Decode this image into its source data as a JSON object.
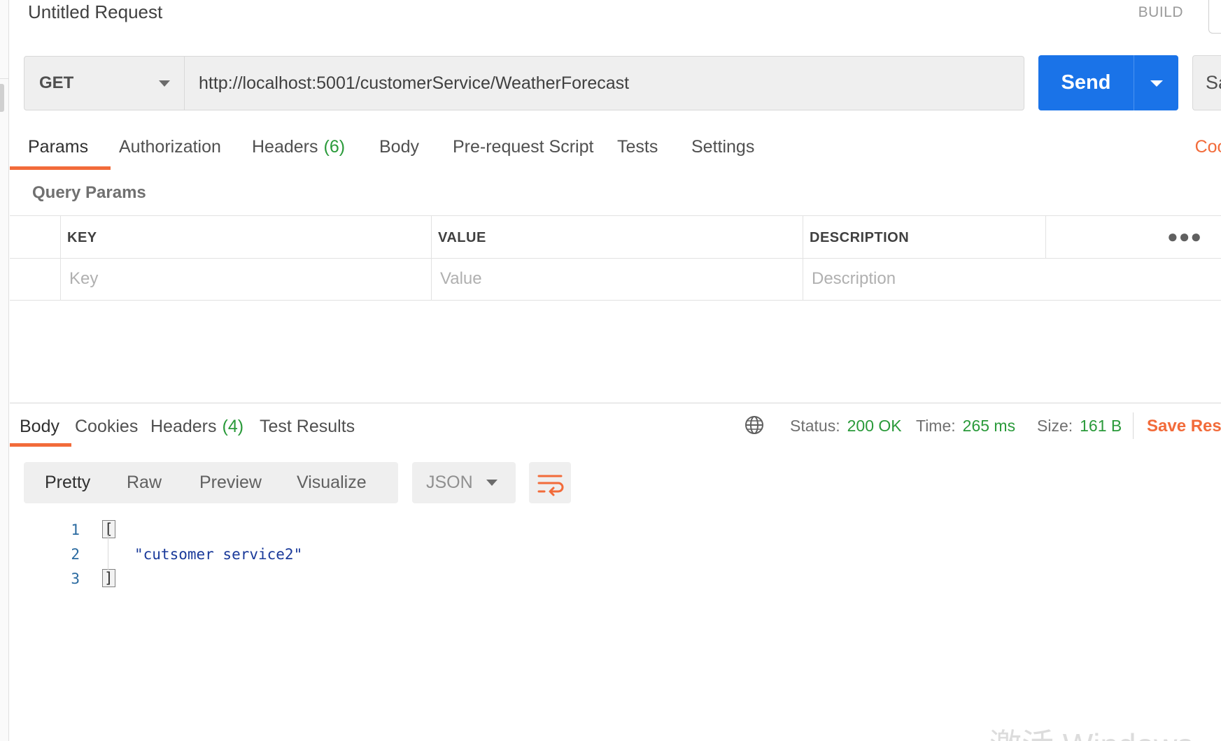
{
  "request": {
    "title": "Untitled Request",
    "build_label": "BUILD",
    "method": "GET",
    "url": "http://localhost:5001/customerService/WeatherForecast",
    "send_label": "Send",
    "save_label": "Sa"
  },
  "request_tabs": [
    {
      "label": "Params",
      "count": "",
      "active": true
    },
    {
      "label": "Authorization",
      "count": ""
    },
    {
      "label": "Headers",
      "count": "(6)"
    },
    {
      "label": "Body",
      "count": ""
    },
    {
      "label": "Pre-request Script",
      "count": ""
    },
    {
      "label": "Tests",
      "count": ""
    },
    {
      "label": "Settings",
      "count": ""
    }
  ],
  "cookies_label": "Cool",
  "query_params": {
    "title": "Query Params",
    "columns": [
      "KEY",
      "VALUE",
      "DESCRIPTION"
    ],
    "placeholders": [
      "Key",
      "Value",
      "Description"
    ],
    "more_icon": "ellipsis-icon"
  },
  "response_tabs": [
    {
      "label": "Body",
      "count": "",
      "active": true
    },
    {
      "label": "Cookies",
      "count": ""
    },
    {
      "label": "Headers",
      "count": "(4)"
    },
    {
      "label": "Test Results",
      "count": ""
    }
  ],
  "response_status": {
    "globe_icon": "globe-icon",
    "status_label": "Status:",
    "status_value": "200 OK",
    "time_label": "Time:",
    "time_value": "265 ms",
    "size_label": "Size:",
    "size_value": "161 B",
    "save_response_label": "Save Res"
  },
  "format_options": [
    "Pretty",
    "Raw",
    "Preview",
    "Visualize"
  ],
  "format_active": "Pretty",
  "language": "JSON",
  "wrap_icon": "wrap-lines-icon",
  "code_lines": [
    {
      "num": "1",
      "text": "["
    },
    {
      "num": "2",
      "text": "\"cutsomer service2\""
    },
    {
      "num": "3",
      "text": "]"
    }
  ],
  "watermark": "激活 Windows",
  "colors": {
    "accent": "#f26b3a",
    "primary": "#1a73e8",
    "success": "#2a9a3a"
  }
}
